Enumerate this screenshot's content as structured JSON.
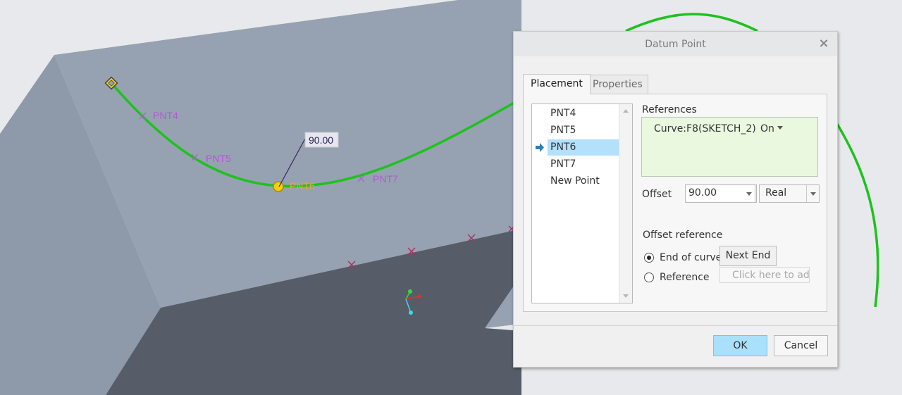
{
  "viewport": {
    "colors": {
      "background": "#e8e9ec",
      "top_face": "#96a2b1",
      "left_face": "#8e9aa9",
      "dark_face": "#565d68",
      "curve": "#1ec21e",
      "point_label": "#b05ad0",
      "active_point": "#f0c000",
      "datum_marker": "#a03060"
    },
    "point_labels": [
      {
        "id": "PNT4",
        "label": "PNT4"
      },
      {
        "id": "PNT5",
        "label": "PNT5"
      },
      {
        "id": "PNT6",
        "label": "PNT6"
      },
      {
        "id": "PNT7",
        "label": "PNT7"
      }
    ],
    "dimension_value": "90.00"
  },
  "dialog": {
    "title": "Datum Point",
    "close_icon": "close-icon",
    "tabs": [
      {
        "label": "Placement",
        "active": true
      },
      {
        "label": "Properties",
        "active": false
      }
    ],
    "points_list": {
      "items": [
        "PNT4",
        "PNT5",
        "PNT6",
        "PNT7",
        "New Point"
      ],
      "selected": "PNT6"
    },
    "references": {
      "label": "References",
      "curve": "Curve:F8(SKETCH_2)",
      "mode": "On"
    },
    "offset": {
      "label": "Offset",
      "value": "90.00",
      "type": "Real"
    },
    "offset_reference": {
      "label": "Offset reference",
      "options": [
        {
          "label": "End of curve",
          "checked": true
        },
        {
          "label": "Reference",
          "checked": false
        }
      ],
      "next_end_label": "Next End",
      "collector_placeholder": "Click here to add"
    },
    "buttons": {
      "ok": "OK",
      "cancel": "Cancel"
    }
  }
}
